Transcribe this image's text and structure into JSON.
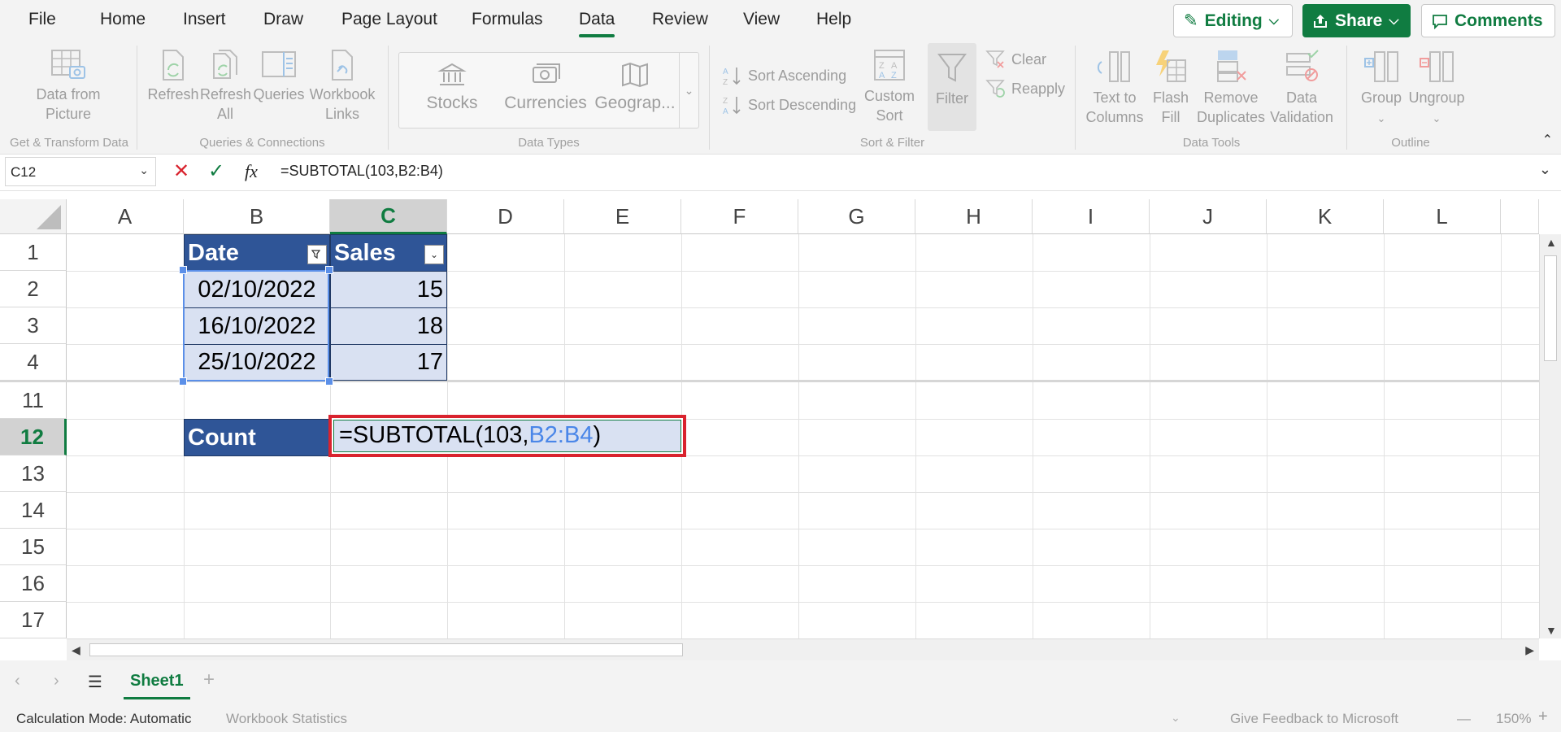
{
  "menu": {
    "tabs": [
      "File",
      "Home",
      "Insert",
      "Draw",
      "Page Layout",
      "Formulas",
      "Data",
      "Review",
      "View",
      "Help"
    ],
    "active": "Data",
    "editing_label": "Editing",
    "share_label": "Share",
    "comments_label": "Comments"
  },
  "ribbon": {
    "data_from_picture": [
      "Data from",
      "Picture"
    ],
    "refresh": "Refresh",
    "refresh_all": [
      "Refresh",
      "All"
    ],
    "queries": "Queries",
    "workbook_links": [
      "Workbook",
      "Links"
    ],
    "stocks": "Stocks",
    "currencies": "Currencies",
    "geography": "Geograp...",
    "sort_asc": "Sort Ascending",
    "sort_desc": "Sort Descending",
    "custom_sort": [
      "Custom",
      "Sort"
    ],
    "filter": "Filter",
    "clear": "Clear",
    "reapply": "Reapply",
    "text_to_columns": [
      "Text to",
      "Columns"
    ],
    "flash_fill": [
      "Flash",
      "Fill"
    ],
    "remove_duplicates": [
      "Remove",
      "Duplicates"
    ],
    "data_validation": [
      "Data",
      "Validation"
    ],
    "group": "Group",
    "ungroup": "Ungroup",
    "groups": {
      "get_transform": "Get & Transform Data",
      "queries_connections": "Queries & Connections",
      "data_types": "Data Types",
      "sort_filter": "Sort & Filter",
      "data_tools": "Data Tools",
      "outline": "Outline"
    }
  },
  "formula_bar": {
    "name_box": "C12",
    "formula": "=SUBTOTAL(103,B2:B4)"
  },
  "grid": {
    "columns": [
      "A",
      "B",
      "C",
      "D",
      "E",
      "F",
      "G",
      "H",
      "I",
      "J",
      "K",
      "L"
    ],
    "selected_column": "C",
    "rows": [
      "1",
      "2",
      "3",
      "4",
      "11",
      "12",
      "13",
      "14",
      "15",
      "16",
      "17"
    ],
    "selected_row": "12",
    "table": {
      "headers": [
        "Date",
        "Sales"
      ],
      "rows": [
        [
          "02/10/2022",
          "15"
        ],
        [
          "16/10/2022",
          "18"
        ],
        [
          "25/10/2022",
          "17"
        ]
      ]
    },
    "count_label": "Count",
    "edit_prefix": "=SUBTOTAL(103,",
    "edit_ref": "B2:B4",
    "edit_suffix": ")"
  },
  "sheets": {
    "tabs": [
      "Sheet1"
    ]
  },
  "status": {
    "calc_mode": "Calculation Mode: Automatic",
    "workbook_stats": "Workbook Statistics",
    "feedback": "Give Feedback to Microsoft",
    "zoom": "150%"
  },
  "colors": {
    "accent": "#107c41",
    "table_header": "#2f5597",
    "table_body": "#d9e1f2",
    "highlight": "#d9232e",
    "reference": "#4a86e8"
  }
}
